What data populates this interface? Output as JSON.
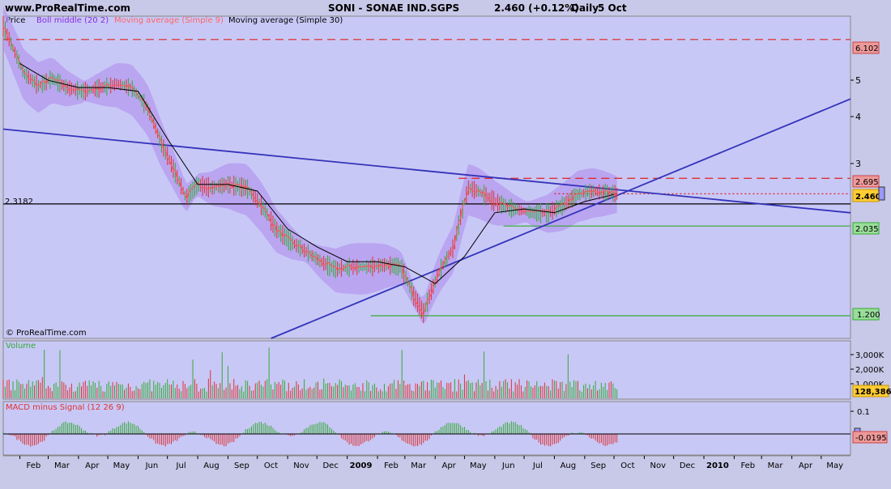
{
  "header": {
    "site": "www.ProRealTime.com",
    "instrument": "SONI - SONAE IND.SGPS",
    "quote": "2.460 (+0.12%)",
    "period": "Daily",
    "date": "5 Oct"
  },
  "price_panel": {
    "legend": [
      {
        "label": "Price",
        "color": "#000000"
      },
      {
        "label": "Boll middle (20 2)",
        "color": "#8a2be2"
      },
      {
        "label": "Moving average (Simple 9)",
        "color": "#ff6666"
      },
      {
        "label": "Moving average (Simple 30)",
        "color": "#000000"
      }
    ],
    "copyright": "© ProRealTime.com",
    "y_ticks": [
      "5",
      "4",
      "3"
    ],
    "level_labels": {
      "resistance_high": "6.102",
      "resistance_mid": "2.695",
      "last_price": "2.460",
      "support_mid": "2.035",
      "support_low": "1.200",
      "horizontal_ref": "2.3182"
    }
  },
  "volume_panel": {
    "label": "Volume",
    "y_ticks": [
      "3,000K",
      "2,000K",
      "1,000K"
    ],
    "last_value": "128,386"
  },
  "macd_panel": {
    "label": "MACD minus Signal (12 26 9)",
    "y_ticks": [
      "0.1"
    ],
    "last_value": "-0.0195"
  },
  "x_axis": {
    "months": [
      "Feb",
      "Mar",
      "Apr",
      "May",
      "Jun",
      "Jul",
      "Aug",
      "Sep",
      "Oct",
      "Nov",
      "Dec",
      "2009",
      "Feb",
      "Mar",
      "Apr",
      "May",
      "Jun",
      "Jul",
      "Aug",
      "Sep",
      "Oct",
      "Nov",
      "Dec",
      "2010",
      "Feb",
      "Mar",
      "Apr",
      "May"
    ]
  },
  "colors": {
    "background": "#c8c8e8",
    "boll_band": "#b496f0",
    "trendline": "#3333bb",
    "support": "#33aa33",
    "resistance": "#dd2222",
    "volume_up": "#33aa33",
    "volume_down": "#dd3333"
  },
  "chart_data": {
    "type": "line",
    "scale": "log",
    "x_start": "2008-01-15",
    "x_end": "2010-05-31",
    "ylim": [
      1.05,
      7.0
    ],
    "price": [
      [
        "2008-01-15",
        6.6
      ],
      [
        "2008-01-25",
        5.8
      ],
      [
        "2008-02-05",
        5.0
      ],
      [
        "2008-02-20",
        4.65
      ],
      [
        "2008-03-05",
        4.85
      ],
      [
        "2008-03-20",
        4.6
      ],
      [
        "2008-04-05",
        4.5
      ],
      [
        "2008-04-25",
        4.6
      ],
      [
        "2008-05-10",
        4.7
      ],
      [
        "2008-05-25",
        4.6
      ],
      [
        "2008-06-10",
        4.1
      ],
      [
        "2008-06-25",
        3.3
      ],
      [
        "2008-07-10",
        2.75
      ],
      [
        "2008-07-20",
        2.4
      ],
      [
        "2008-08-01",
        2.6
      ],
      [
        "2008-08-15",
        2.55
      ],
      [
        "2008-09-01",
        2.6
      ],
      [
        "2008-09-20",
        2.55
      ],
      [
        "2008-10-05",
        2.3
      ],
      [
        "2008-10-20",
        2.0
      ],
      [
        "2008-11-05",
        1.85
      ],
      [
        "2008-11-20",
        1.75
      ],
      [
        "2008-12-05",
        1.65
      ],
      [
        "2008-12-20",
        1.58
      ],
      [
        "2009-01-05",
        1.6
      ],
      [
        "2009-01-20",
        1.6
      ],
      [
        "2009-02-10",
        1.62
      ],
      [
        "2009-02-25",
        1.6
      ],
      [
        "2009-03-10",
        1.35
      ],
      [
        "2009-03-20",
        1.22
      ],
      [
        "2009-04-05",
        1.55
      ],
      [
        "2009-04-20",
        1.8
      ],
      [
        "2009-05-05",
        2.55
      ],
      [
        "2009-05-15",
        2.5
      ],
      [
        "2009-06-01",
        2.35
      ],
      [
        "2009-06-20",
        2.25
      ],
      [
        "2009-07-10",
        2.2
      ],
      [
        "2009-07-25",
        2.2
      ],
      [
        "2009-08-10",
        2.3
      ],
      [
        "2009-08-25",
        2.45
      ],
      [
        "2009-09-10",
        2.5
      ],
      [
        "2009-09-25",
        2.48
      ],
      [
        "2009-10-05",
        2.46
      ]
    ],
    "ma30": [
      [
        "2008-02-01",
        5.3
      ],
      [
        "2008-03-01",
        4.8
      ],
      [
        "2008-04-01",
        4.6
      ],
      [
        "2008-05-01",
        4.6
      ],
      [
        "2008-06-01",
        4.5
      ],
      [
        "2008-07-01",
        3.4
      ],
      [
        "2008-08-01",
        2.6
      ],
      [
        "2008-09-01",
        2.6
      ],
      [
        "2008-10-01",
        2.5
      ],
      [
        "2008-11-01",
        2.0
      ],
      [
        "2008-12-01",
        1.8
      ],
      [
        "2009-01-01",
        1.65
      ],
      [
        "2009-02-01",
        1.65
      ],
      [
        "2009-03-01",
        1.6
      ],
      [
        "2009-04-01",
        1.45
      ],
      [
        "2009-05-01",
        1.7
      ],
      [
        "2009-06-01",
        2.2
      ],
      [
        "2009-07-01",
        2.25
      ],
      [
        "2009-08-01",
        2.2
      ],
      [
        "2009-09-01",
        2.35
      ],
      [
        "2009-10-01",
        2.45
      ]
    ],
    "trendlines": [
      {
        "from": [
          "2008-01-15",
          3.6
        ],
        "to": [
          "2010-05-31",
          2.2
        ]
      },
      {
        "from": [
          "2008-10-15",
          1.05
        ],
        "to": [
          "2010-05-31",
          4.3
        ]
      }
    ],
    "levels": [
      {
        "value": 6.102,
        "style": "dashed",
        "color": "#dd2222",
        "from": "2008-01-15"
      },
      {
        "value": 2.695,
        "style": "dashed",
        "color": "#dd2222",
        "from": "2009-04-25"
      },
      {
        "value": 2.46,
        "style": "dotted",
        "color": "#dd2222",
        "from": "2009-08-01"
      },
      {
        "value": 2.3182,
        "style": "solid",
        "color": "#000000",
        "from": "2008-01-15"
      },
      {
        "value": 2.035,
        "style": "solid",
        "color": "#33aa33",
        "from": "2009-06-10"
      },
      {
        "value": 1.2,
        "style": "solid",
        "color": "#33aa33",
        "from": "2009-01-25"
      }
    ]
  }
}
